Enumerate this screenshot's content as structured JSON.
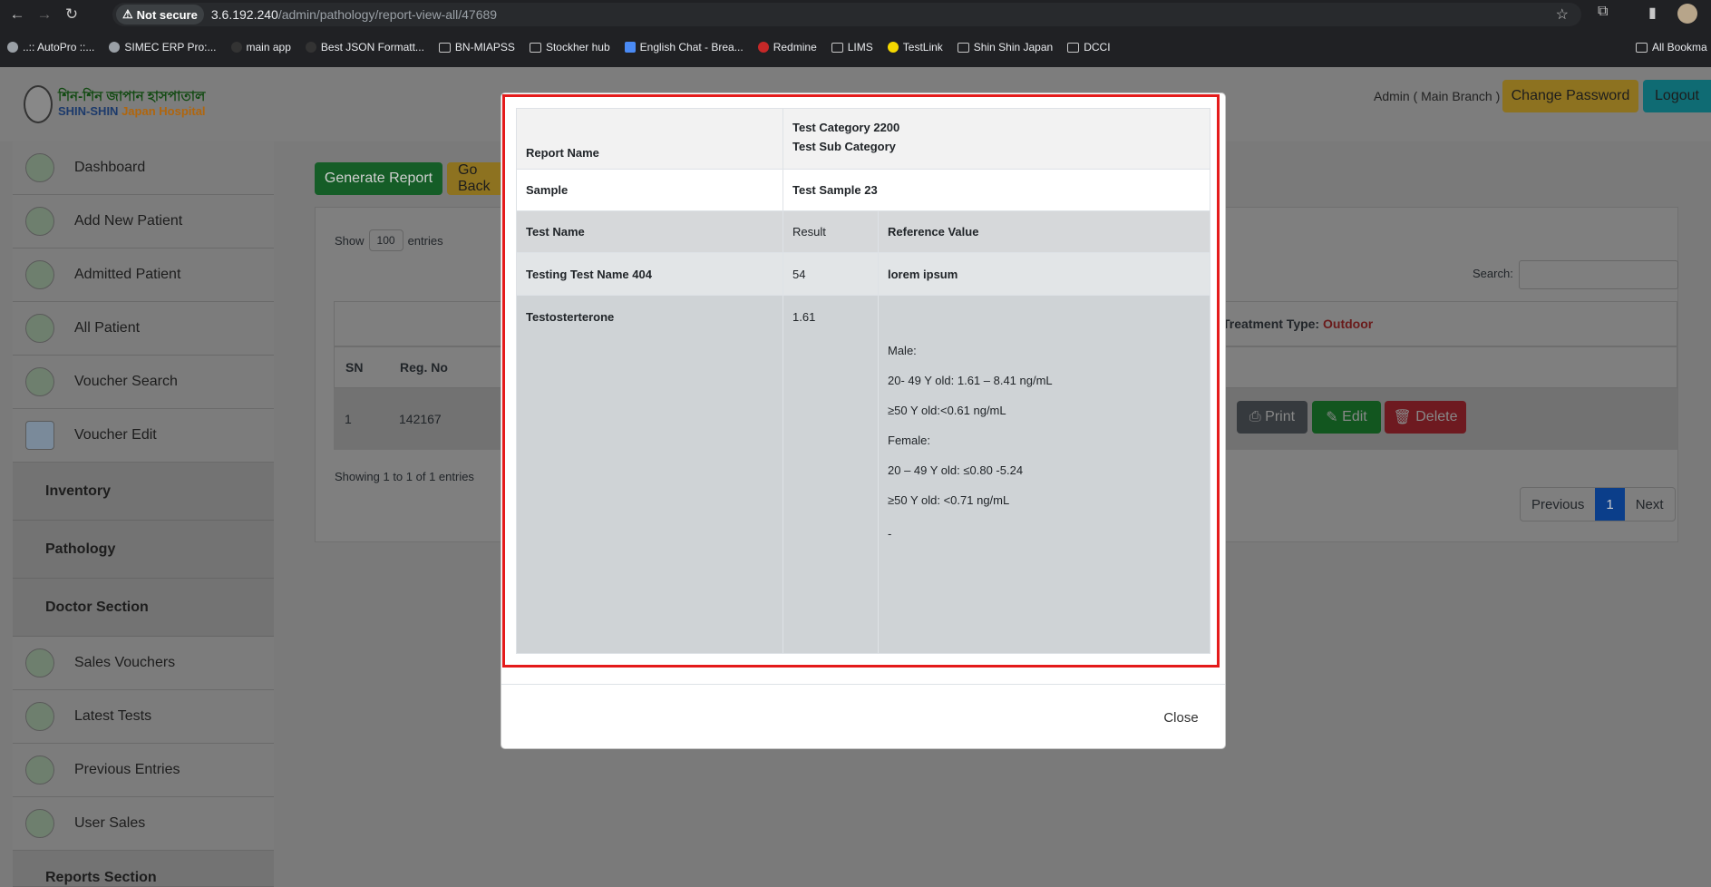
{
  "browser": {
    "security_label": "Not secure",
    "url_host": "3.6.192.240",
    "url_path": "/admin/pathology/report-view-all/47689",
    "bookmarks": [
      {
        "label": "..:: AutoPro ::...",
        "type": "site"
      },
      {
        "label": "SIMEC ERP Pro:...",
        "type": "site"
      },
      {
        "label": "main app",
        "type": "site"
      },
      {
        "label": "Best JSON Formatt...",
        "type": "site"
      },
      {
        "label": "BN-MIAPSS",
        "type": "folder"
      },
      {
        "label": "Stockher hub",
        "type": "folder"
      },
      {
        "label": "English Chat - Brea...",
        "type": "site"
      },
      {
        "label": "Redmine",
        "type": "site"
      },
      {
        "label": "LIMS",
        "type": "folder"
      },
      {
        "label": "TestLink",
        "type": "site"
      },
      {
        "label": "Shin Shin Japan",
        "type": "folder"
      },
      {
        "label": "DCCI",
        "type": "folder"
      }
    ],
    "all_bookmarks": "All Bookma"
  },
  "header": {
    "logo_line1": "শিন-শিন জাপান হাসপাতাল",
    "logo_line2a": "SHIN-SHIN",
    "logo_line2b": "Japan Hospital",
    "admin_label": "Admin ( Main Branch )",
    "change_password": "Change Password",
    "logout": "Logout"
  },
  "sidebar": {
    "items": [
      {
        "label": "Dashboard"
      },
      {
        "label": "Add New Patient"
      },
      {
        "label": "Admitted Patient"
      },
      {
        "label": "All Patient"
      },
      {
        "label": "Voucher Search"
      },
      {
        "label": "Voucher Edit"
      }
    ],
    "sections": [
      "Inventory",
      "Pathology",
      "Doctor Section"
    ],
    "items2": [
      {
        "label": "Sales Vouchers"
      },
      {
        "label": "Latest Tests"
      },
      {
        "label": "Previous Entries"
      },
      {
        "label": "User Sales"
      }
    ],
    "more": "Reports Section"
  },
  "page": {
    "generate_report": "Generate Report",
    "go_back": "Go Back",
    "show_label": "Show",
    "entries_value": "100",
    "entries_label": "entries",
    "search_label": "Search:",
    "treatment_type_label": "Treatment Type:",
    "treatment_type_value": "Outdoor",
    "col_sn": "SN",
    "col_reg": "Reg. No",
    "row_sn": "1",
    "row_reg": "142167",
    "print": "Print",
    "edit": "Edit",
    "delete": "Delete",
    "showing": "Showing 1 to 1 of 1 entries",
    "previous": "Previous",
    "page_num": "1",
    "next": "Next"
  },
  "modal": {
    "report_name_label": "Report Name",
    "category": "Test Category 2200",
    "sub_category": "Test Sub Category",
    "sample_label": "Sample",
    "sample_value": "Test Sample 23",
    "col_test_name": "Test Name",
    "col_result": "Result",
    "col_reference": "Reference Value",
    "rows": [
      {
        "name": "Testing Test Name 404",
        "result": "54",
        "reference": "lorem ipsum"
      },
      {
        "name": "Testosterterone",
        "result": "1.61"
      }
    ],
    "reference_lines": [
      "Male:",
      "20- 49 Y old: 1.61 – 8.41 ng/mL",
      "≥50  Y old:<0.61 ng/mL",
      "Female:",
      "20 – 49 Y old: ≤0.80 -5.24",
      "≥50 Y old: <0.71 ng/mL",
      "-"
    ],
    "close": "Close"
  }
}
